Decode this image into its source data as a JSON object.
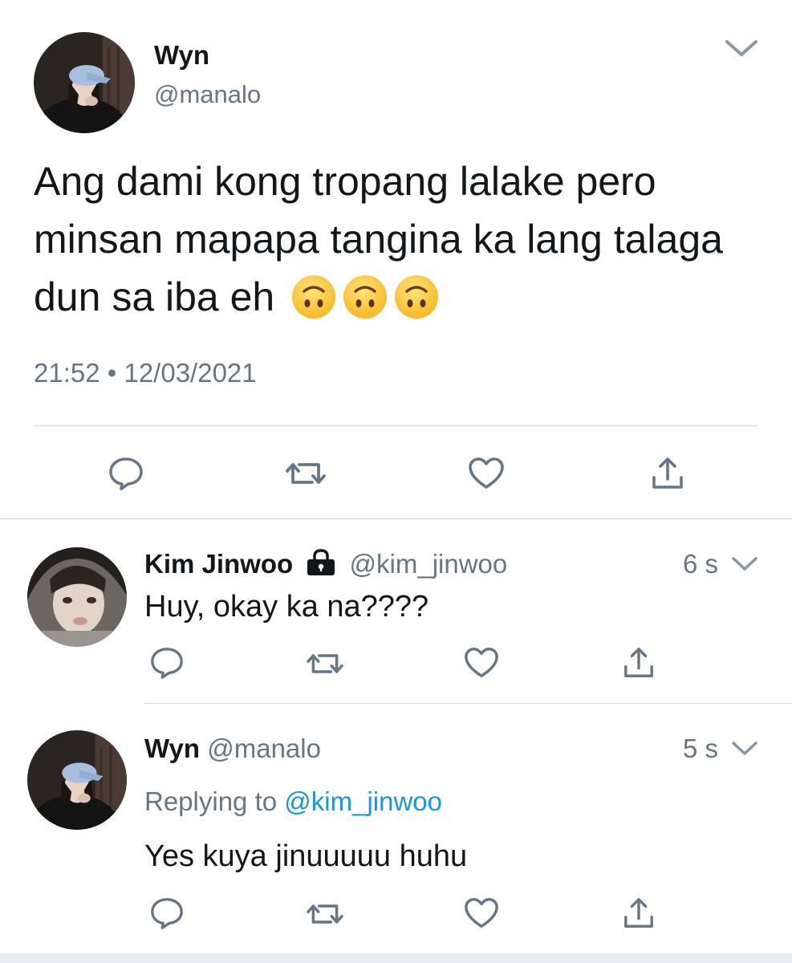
{
  "main_tweet": {
    "author_name": "Wyn",
    "author_handle": "@manalo",
    "text": "Ang dami kong tropang lalake pero minsan mapapa tangina ka lang talaga dun sa iba eh",
    "emojis": [
      "upside-down-face",
      "upside-down-face",
      "upside-down-face"
    ],
    "timestamp": "21:52 • 12/03/2021"
  },
  "replies": [
    {
      "author_name": "Kim Jinwoo",
      "lock_icon": "lock-icon",
      "author_handle": "@kim_jinwoo",
      "time": "6 s",
      "text": "Huy, okay ka na????"
    },
    {
      "author_name": "Wyn",
      "author_handle": "@manalo",
      "time": "5 s",
      "replying_prefix": "Replying to",
      "replying_to": "@kim_jinwoo",
      "text": "Yes kuya jinuuuuu huhu"
    }
  ],
  "actions": [
    "reply-icon",
    "retweet-icon",
    "like-icon",
    "share-icon"
  ],
  "colors": {
    "text": "#14171a",
    "secondary": "#657786",
    "link": "#1b95e0",
    "divider": "#d6dadf",
    "icon": "#657786"
  }
}
